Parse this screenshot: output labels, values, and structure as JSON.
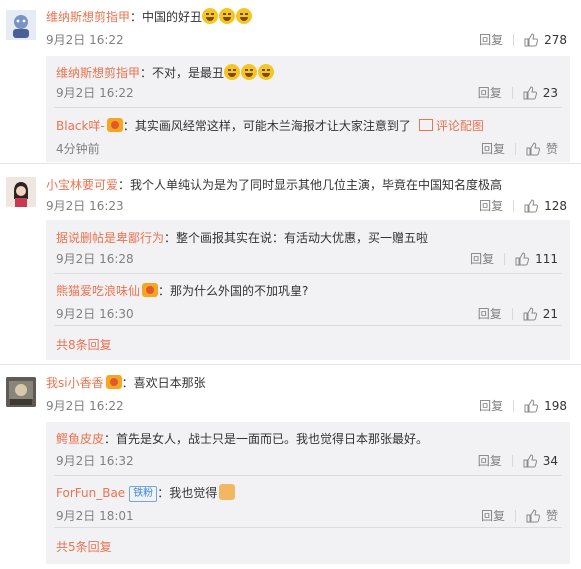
{
  "common": {
    "reply": "回复",
    "like_count_label": "赞"
  },
  "comments": [
    {
      "user": "维纳斯想剪指甲",
      "text": "中国的好丑",
      "emoji": [
        "laugh-cry-emoji",
        "laugh-cry-emoji",
        "laugh-cry-emoji"
      ],
      "time": "9月2日 16:22",
      "likes": "278",
      "replies": [
        {
          "user": "维纳斯想剪指甲",
          "text": "不对，是最丑",
          "time": "9月2日 16:22",
          "likes": "23"
        },
        {
          "user": "Black咩-",
          "text": "其实画风经常这样，可能木兰海报才让大家注意到了",
          "link": "评论配图",
          "time": "4分钟前",
          "likes": "赞"
        }
      ]
    },
    {
      "user": "小宝林要可爱",
      "text": "我个人单纯认为是为了同时显示其他几位主演，毕竟在中国知名度极高",
      "time": "9月2日 16:23",
      "likes": "128",
      "replies": [
        {
          "user": "据说删帖是卑鄙行为",
          "text": "整个画报其实在说：有活动大优惠，买一赠五啦",
          "time": "9月2日 16:28",
          "likes": "111"
        },
        {
          "user": "熊猫爱吃浪味仙",
          "text": "那为什么外国的不加巩皇?",
          "time": "9月2日 16:30",
          "likes": "21"
        }
      ],
      "more": "共8条回复"
    },
    {
      "user": "我si小香香",
      "text": "喜欢日本那张",
      "time": "9月2日 16:22",
      "likes": "198",
      "replies": [
        {
          "user": "鳄鱼皮皮",
          "text": "首先是女人，战士只是一面而已。我也觉得日本那张最好。",
          "time": "9月2日 16:32",
          "likes": "34"
        },
        {
          "user": "ForFun_Bae",
          "badge": "铁粉",
          "text": "我也觉得",
          "time": "9月2日 18:01",
          "likes": "赞"
        }
      ],
      "more": "共5条回复"
    }
  ]
}
